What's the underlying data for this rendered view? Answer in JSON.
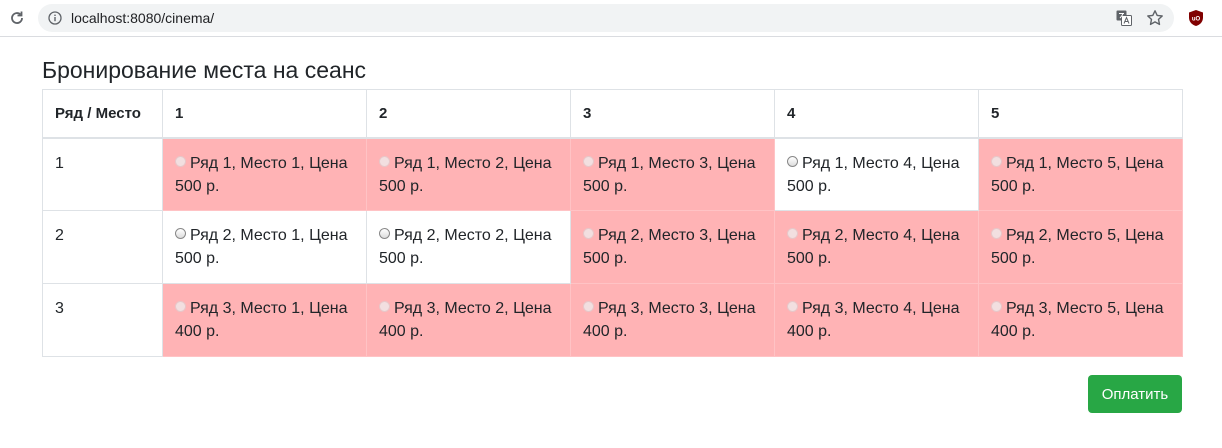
{
  "browser": {
    "url": "localhost:8080/cinema/"
  },
  "page": {
    "title": "Бронирование места на сеанс"
  },
  "table": {
    "header": [
      "Ряд / Место",
      "1",
      "2",
      "3",
      "4",
      "5"
    ],
    "rows": [
      {
        "row_label": "1",
        "seats": [
          {
            "label": "Ряд 1, Место 1, Цена 500 р.",
            "taken": true
          },
          {
            "label": "Ряд 1, Место 2, Цена 500 р.",
            "taken": true
          },
          {
            "label": "Ряд 1, Место 3, Цена 500 р.",
            "taken": true
          },
          {
            "label": "Ряд 1, Место 4, Цена 500 р.",
            "taken": false
          },
          {
            "label": "Ряд 1, Место 5, Цена 500 р.",
            "taken": true
          }
        ]
      },
      {
        "row_label": "2",
        "seats": [
          {
            "label": "Ряд 2, Место 1, Цена 500 р.",
            "taken": false
          },
          {
            "label": "Ряд 2, Место 2, Цена 500 р.",
            "taken": false
          },
          {
            "label": "Ряд 2, Место 3, Цена 500 р.",
            "taken": true
          },
          {
            "label": "Ряд 2, Место 4, Цена 500 р.",
            "taken": true
          },
          {
            "label": "Ряд 2, Место 5, Цена 500 р.",
            "taken": true
          }
        ]
      },
      {
        "row_label": "3",
        "seats": [
          {
            "label": "Ряд 3, Место 1, Цена 400 р.",
            "taken": true
          },
          {
            "label": "Ряд 3, Место 2, Цена 400 р.",
            "taken": true
          },
          {
            "label": "Ряд 3, Место 3, Цена 400 р.",
            "taken": true
          },
          {
            "label": "Ряд 3, Место 4, Цена 400 р.",
            "taken": true
          },
          {
            "label": "Ряд 3, Место 5, Цена 400 р.",
            "taken": true
          }
        ]
      }
    ]
  },
  "actions": {
    "pay_label": "Оплатить"
  },
  "colors": {
    "taken_seat_bg": "#ffb3b5",
    "pay_button_bg": "#28a745"
  }
}
